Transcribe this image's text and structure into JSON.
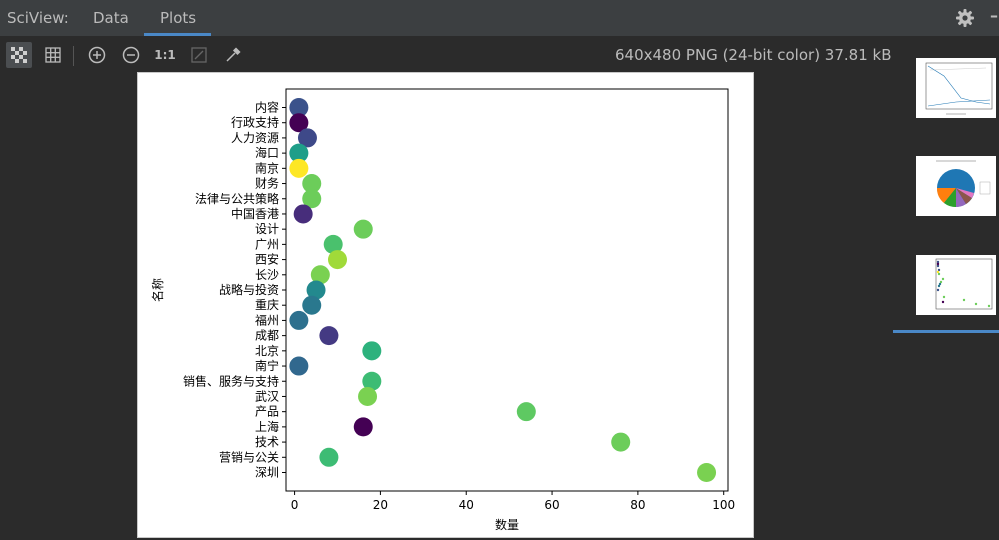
{
  "window": {
    "title": "SciView:",
    "tabs": [
      {
        "label": "Data",
        "active": false
      },
      {
        "label": "Plots",
        "active": true
      }
    ],
    "accent_color": "#4a88c7"
  },
  "toolbar": {
    "buttons": [
      {
        "name": "checkerboard-icon"
      },
      {
        "name": "grid-icon"
      },
      {
        "name": "zoom-in-icon"
      },
      {
        "name": "zoom-out-icon"
      },
      {
        "name": "actual-size",
        "label": "1:1"
      },
      {
        "name": "fit-icon"
      },
      {
        "name": "color-picker-icon"
      }
    ],
    "image_info": "640x480 PNG (24-bit color) 37.81 kB"
  },
  "chart_data": {
    "type": "scatter",
    "xlabel": "数量",
    "ylabel": "名称",
    "xlim": [
      -2,
      101
    ],
    "xticks": [
      0,
      20,
      40,
      60,
      80,
      100
    ],
    "categories": [
      "内容",
      "行政支持",
      "人力资源",
      "海口",
      "南京",
      "财务",
      "法律与公共策略",
      "中国香港",
      "设计",
      "广州",
      "西安",
      "长沙",
      "战略与投资",
      "重庆",
      "福州",
      "成都",
      "北京",
      "南宁",
      "销售、服务与支持",
      "武汉",
      "产品",
      "上海",
      "技术",
      "营销与公关",
      "深圳"
    ],
    "points": [
      {
        "category": "内容",
        "x": 1,
        "color": "#3b528b"
      },
      {
        "category": "行政支持",
        "x": 1,
        "color": "#440154"
      },
      {
        "category": "人力资源",
        "x": 3,
        "color": "#3e4989"
      },
      {
        "category": "海口",
        "x": 1,
        "color": "#1f9e89"
      },
      {
        "category": "南京",
        "x": 1,
        "color": "#fde725"
      },
      {
        "category": "财务",
        "x": 4,
        "color": "#6ccd5a"
      },
      {
        "category": "法律与公共策略",
        "x": 4,
        "color": "#6ccd5a"
      },
      {
        "category": "中国香港",
        "x": 2,
        "color": "#472d7b"
      },
      {
        "category": "设计",
        "x": 16,
        "color": "#6ccd5a"
      },
      {
        "category": "广州",
        "x": 9,
        "color": "#4ac16d"
      },
      {
        "category": "西安",
        "x": 10,
        "color": "#a0da39"
      },
      {
        "category": "长沙",
        "x": 6,
        "color": "#7ad151"
      },
      {
        "category": "战略与投资",
        "x": 5,
        "color": "#23898e"
      },
      {
        "category": "重庆",
        "x": 4,
        "color": "#2a788e"
      },
      {
        "category": "福州",
        "x": 1,
        "color": "#2d708e"
      },
      {
        "category": "成都",
        "x": 8,
        "color": "#443a83"
      },
      {
        "category": "北京",
        "x": 18,
        "color": "#2db27d"
      },
      {
        "category": "南宁",
        "x": 1,
        "color": "#31688e"
      },
      {
        "category": "销售、服务与支持",
        "x": 18,
        "color": "#3dbc74"
      },
      {
        "category": "武汉",
        "x": 17,
        "color": "#7ad151"
      },
      {
        "category": "产品",
        "x": 54,
        "color": "#5ec962"
      },
      {
        "category": "上海",
        "x": 16,
        "color": "#440154"
      },
      {
        "category": "技术",
        "x": 76,
        "color": "#6ccd5a"
      },
      {
        "category": "营销与公关",
        "x": 8,
        "color": "#3dbc74"
      },
      {
        "category": "深圳",
        "x": 96,
        "color": "#7ad151"
      }
    ]
  },
  "thumbnails": [
    {
      "name": "thumbnail-line-plot",
      "selected": false
    },
    {
      "name": "thumbnail-pie-chart",
      "selected": false
    },
    {
      "name": "thumbnail-scatter-plot",
      "selected": true
    }
  ]
}
